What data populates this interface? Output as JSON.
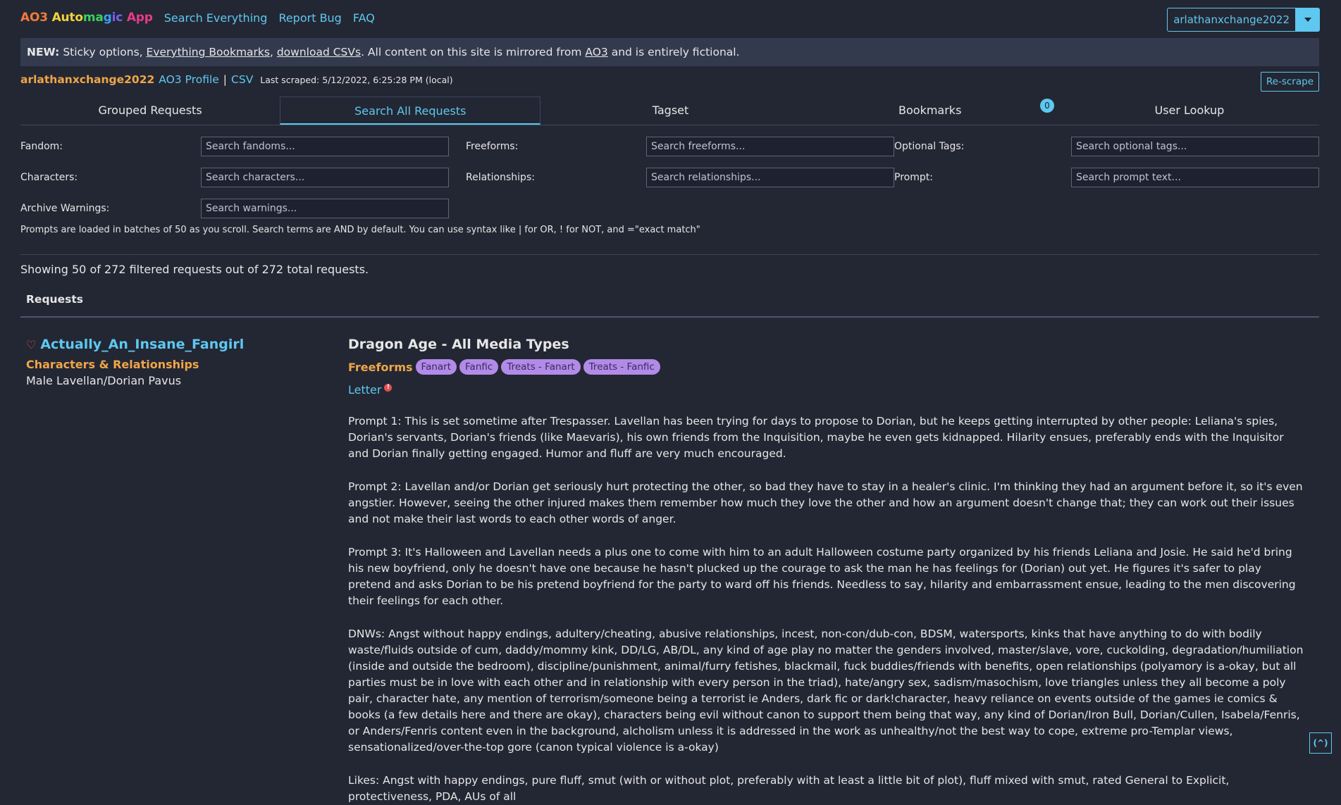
{
  "header": {
    "brand_parts": [
      {
        "text": "AO3 ",
        "color": "#f07b3a"
      },
      {
        "text": "Auto",
        "color": "#f0d33a"
      },
      {
        "text": "ma",
        "color": "#3ad15e"
      },
      {
        "text": "g",
        "color": "#3a9ef0"
      },
      {
        "text": "ic",
        "color": "#7b5ef0"
      },
      {
        "text": " App",
        "color": "#e83a8a"
      }
    ],
    "nav": [
      "Search Everything",
      "Report Bug",
      "FAQ"
    ],
    "user_dropdown": "arlathanxchange2022"
  },
  "banner": {
    "new_label": "NEW:",
    "text1": " Sticky options, ",
    "link1": "Everything Bookmarks",
    "text2": ", ",
    "link2": "download CSVs",
    "text3": ". All content on this site is mirrored from ",
    "link3": "AO3",
    "text4": " and is entirely fictional."
  },
  "userline": {
    "username": "arlathanxchange2022",
    "profile": "AO3 Profile",
    "sep": "|",
    "csv": "CSV",
    "last_scraped": "Last scraped: 5/12/2022, 6:25:28 PM (local)",
    "rescrape": "Re-scrape"
  },
  "tabs": [
    "Grouped Requests",
    "Search All Requests",
    "Tagset",
    "Bookmarks",
    "User Lookup"
  ],
  "bookmarks_count": "0",
  "filters": {
    "fandom_label": "Fandom:",
    "fandom_ph": "Search fandoms...",
    "freeforms_label": "Freeforms:",
    "freeforms_ph": "Search freeforms...",
    "optional_label": "Optional Tags:",
    "optional_ph": "Search optional tags...",
    "characters_label": "Characters:",
    "characters_ph": "Search characters...",
    "relationships_label": "Relationships:",
    "relationships_ph": "Search relationships...",
    "prompt_label": "Prompt:",
    "prompt_ph": "Search prompt text...",
    "warnings_label": "Archive Warnings:",
    "warnings_ph": "Search warnings...",
    "hint": "Prompts are loaded in batches of 50 as you scroll. Search terms are AND by default. You can use syntax like | for OR, ! for NOT, and =\"exact match\""
  },
  "showing": "Showing 50 of 272 filtered requests out of 272 total requests.",
  "requests_heading": "Requests",
  "request": {
    "requester": "Actually_An_Insane_Fangirl",
    "category_label": "Characters & Relationships",
    "category_value": "Male Lavellan/Dorian Pavus",
    "fandom": "Dragon Age - All Media Types",
    "freeforms_label": "Freeforms",
    "tags": [
      "Fanart",
      "Fanfic",
      "Treats - Fanart",
      "Treats - Fanfic"
    ],
    "letter": "Letter",
    "alert": "!",
    "prompts": [
      "Prompt 1: This is set sometime after Trespasser. Lavellan has been trying for days to propose to Dorian, but he keeps getting interrupted by other people: Leliana's spies, Dorian's servants, Dorian's friends (like Maevaris), his own friends from the Inquisition, maybe he even gets kidnapped. Hilarity ensues, preferably ends with the Inquisitor and Dorian finally getting engaged. Humor and fluff are very much encouraged.",
      "Prompt 2: Lavellan and/or Dorian get seriously hurt protecting the other, so bad they have to stay in a healer's clinic. I'm thinking they had an argument before it, so it's even angstier. However, seeing the other injured makes them remember how much they love the other and how an argument doesn't change that; they can work out their issues and not make their last words to each other words of anger.",
      "Prompt 3: It's Halloween and Lavellan needs a plus one to come with him to an adult Halloween costume party organized by his friends Leliana and Josie. He said he'd bring his new boyfriend, only he doesn't have one because he hasn't plucked up the courage to ask the man he has feelings for (Dorian) out yet. He figures it's safer to play pretend and asks Dorian to be his pretend boyfriend for the party to ward off his friends. Needless to say, hilarity and embarrassment ensue, leading to the men discovering their feelings for each other.",
      "DNWs: Angst without happy endings, adultery/cheating, abusive relationships, incest, non-con/dub-con, BDSM, watersports, kinks that have anything to do with bodily waste/fluids outside of cum, daddy/mommy kink, DD/LG, AB/DL, any kind of age play no matter the genders involved, master/slave, vore, cuckolding, degradation/humiliation (inside and outside the bedroom), discipline/punishment, animal/furry fetishes, blackmail, fuck buddies/friends with benefits, open relationships (polyamory is a-okay, but all parties must be in love with each other and in relationship with every person in the triad), hate/angry sex, sadism/masochism, love triangles unless they all become a poly pair, character hate, any mention of terrorism/someone being a terrorist ie Anders, dark fic or dark!character, heavy reliance on events outside of the games ie comics & books (a few details here and there are okay), characters being evil without canon to support them being that way, any kind of Dorian/Iron Bull, Dorian/Cullen, Isabela/Fenris, or Anders/Fenris content even in the background, alcholism unless it is addressed in the work as unhealthy/not the best way to cope, extreme pro-Templar views, sensationalized/over-the-top gore (canon typical violence is a-okay)",
      "Likes: Angst with happy endings, pure fluff, smut (with or without plot, preferably with at least a little bit of plot), fluff mixed with smut, rated General to Explicit, protectiveness, PDA, AUs of all"
    ]
  },
  "scroll_top": "(^)"
}
